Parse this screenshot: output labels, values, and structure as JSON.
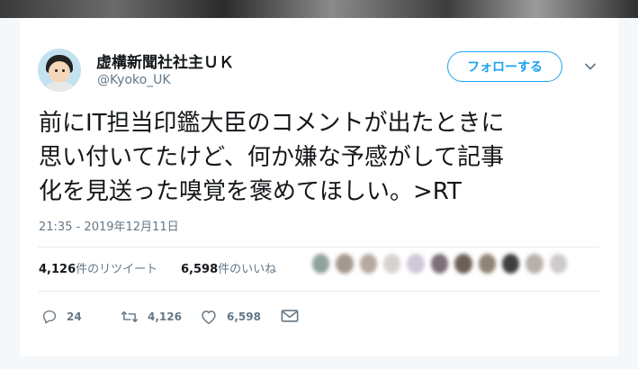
{
  "tweet": {
    "display_name": "虚構新聞社社主ＵＫ",
    "handle": "@Kyoko_UK",
    "follow_label": "フォローする",
    "text_lines": [
      "前にIT担当印鑑大臣のコメントが出たときに",
      "思い付いてたけど、何か嫌な予感がして記事",
      "化を見送った嗅覚を褒めてほしい。>RT"
    ],
    "timestamp": "21:35 - 2019年12月11日"
  },
  "stats": {
    "retweets_count": "4,126",
    "retweets_label": "件のリツイート",
    "likes_count": "6,598",
    "likes_label": "件のいいね"
  },
  "actions": {
    "reply_count": "24",
    "retweet_count": "4,126",
    "like_count": "6,598"
  },
  "colors": {
    "accent": "#1da1f2",
    "secondary_text": "#657786",
    "liker_colors": [
      "#8fa39a",
      "#a5978c",
      "#b6a9a0",
      "#d8d2cf",
      "#cfc8d8",
      "#7d6f78",
      "#6e5f55",
      "#908476",
      "#3e3e3e",
      "#b8b1a8",
      "#cfcaca"
    ]
  },
  "icons": [
    "avatar",
    "chevron-down-icon",
    "reply-icon",
    "retweet-icon",
    "heart-icon",
    "mail-icon"
  ]
}
